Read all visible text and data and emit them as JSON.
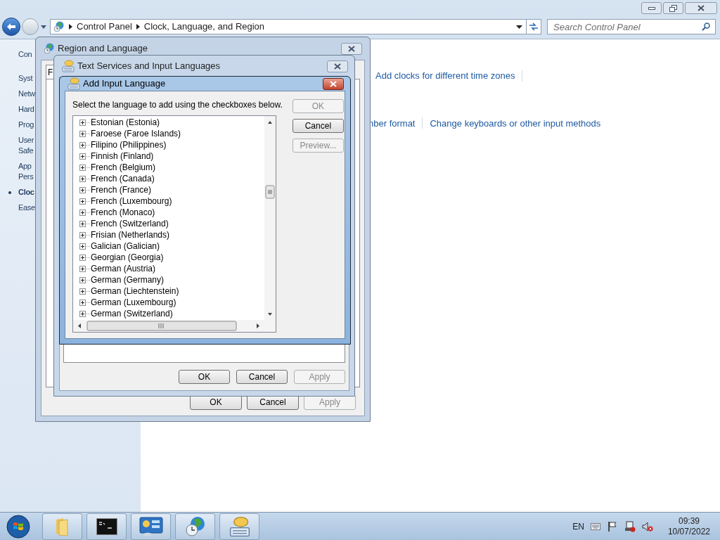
{
  "explorer": {
    "breadcrumb": [
      "Control Panel",
      "Clock, Language, and Region"
    ],
    "search": {
      "placeholder": "Search Control Panel"
    },
    "sidebar": {
      "items": [
        {
          "lines": [
            "Con"
          ],
          "selected": false
        },
        {
          "lines": [
            "Syst"
          ],
          "selected": false
        },
        {
          "lines": [
            "Netw"
          ],
          "selected": false
        },
        {
          "lines": [
            "Hard"
          ],
          "selected": false
        },
        {
          "lines": [
            "Prog"
          ],
          "selected": false
        },
        {
          "lines": [
            "User",
            "Safe"
          ],
          "selected": false
        },
        {
          "lines": [
            "App",
            "Pers"
          ],
          "selected": false
        },
        {
          "lines": [
            "Cloc"
          ],
          "selected": true
        },
        {
          "lines": [
            "Ease"
          ],
          "selected": false
        }
      ]
    },
    "link_rows": [
      [
        "Add clocks for different time zones"
      ],
      [
        "nber format",
        "Change keyboards or other input methods"
      ]
    ]
  },
  "region_dialog": {
    "title": "Region and Language",
    "tabs": [
      {
        "label": "F",
        "selected": true
      }
    ],
    "buttons": [
      {
        "label": "OK",
        "disabled": false
      },
      {
        "label": "Cancel",
        "disabled": false
      },
      {
        "label": "Apply",
        "disabled": true
      }
    ]
  },
  "text_services_dialog": {
    "title": "Text Services and Input Languages",
    "buttons": [
      {
        "label": "OK",
        "disabled": false
      },
      {
        "label": "Cancel",
        "disabled": false
      },
      {
        "label": "Apply",
        "disabled": true
      }
    ]
  },
  "add_language_dialog": {
    "title": "Add Input Language",
    "instruction": "Select the language to add using the checkboxes below.",
    "languages": [
      {
        "label": "Estonian (Estonia)",
        "expanded": false
      },
      {
        "label": "Faroese (Faroe Islands)",
        "expanded": false
      },
      {
        "label": "Filipino (Philippines)",
        "expanded": false
      },
      {
        "label": "Finnish (Finland)",
        "expanded": false
      },
      {
        "label": "French (Belgium)",
        "expanded": false
      },
      {
        "label": "French (Canada)",
        "expanded": false
      },
      {
        "label": "French (France)",
        "expanded": false
      },
      {
        "label": "French (Luxembourg)",
        "expanded": false
      },
      {
        "label": "French (Monaco)",
        "expanded": false
      },
      {
        "label": "French (Switzerland)",
        "expanded": false
      },
      {
        "label": "Frisian (Netherlands)",
        "expanded": false
      },
      {
        "label": "Galician (Galician)",
        "expanded": false
      },
      {
        "label": "Georgian (Georgia)",
        "expanded": false
      },
      {
        "label": "German (Austria)",
        "expanded": false
      },
      {
        "label": "German (Germany)",
        "expanded": false
      },
      {
        "label": "German (Liechtenstein)",
        "expanded": false
      },
      {
        "label": "German (Luxembourg)",
        "expanded": false
      },
      {
        "label": "German (Switzerland)",
        "expanded": false
      }
    ],
    "buttons": [
      {
        "label": "OK",
        "disabled": true
      },
      {
        "label": "Cancel",
        "disabled": false
      },
      {
        "label": "Preview...",
        "disabled": true
      }
    ]
  },
  "taskbar": {
    "apps": [
      {
        "kind": "folder"
      },
      {
        "kind": "console"
      },
      {
        "kind": "control-panel"
      },
      {
        "kind": "globe-clock"
      },
      {
        "kind": "keyboard-speech"
      }
    ],
    "tray": {
      "language": "EN",
      "time": "09:39",
      "date": "10/07/2022"
    }
  }
}
